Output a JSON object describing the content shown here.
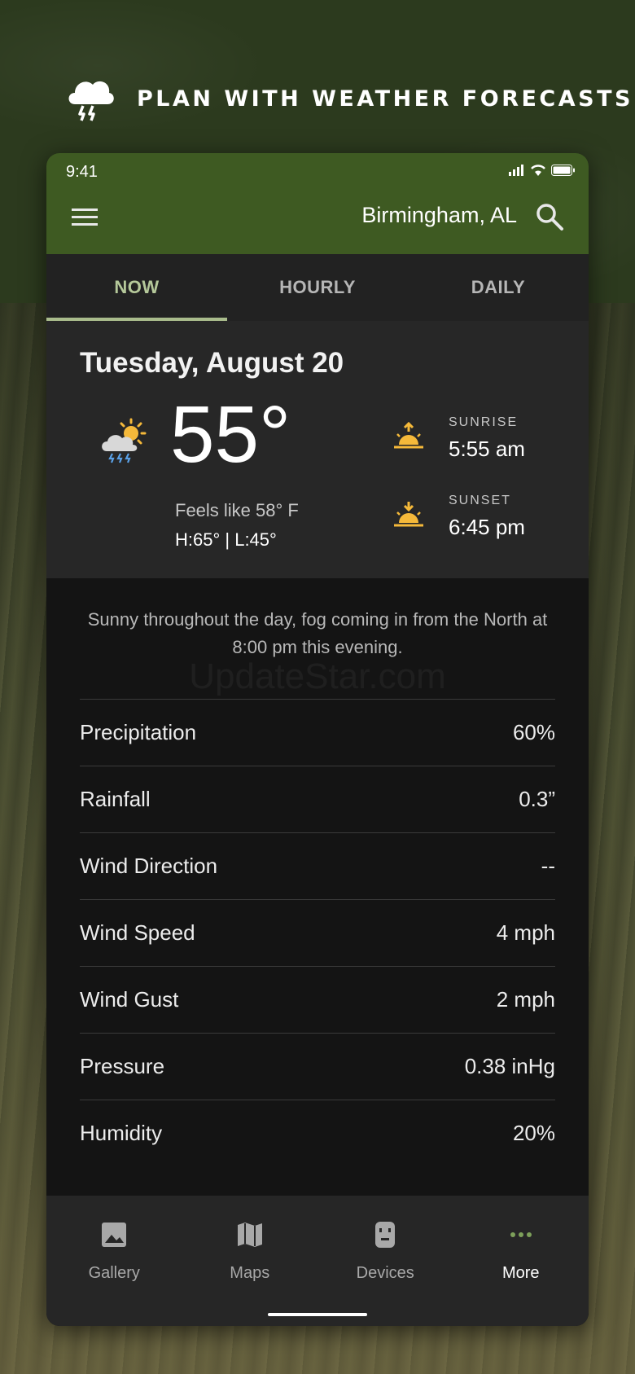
{
  "banner": {
    "title": "PLAN WITH WEATHER FORECASTS",
    "icon": "storm-cloud-icon"
  },
  "status_bar": {
    "time": "9:41"
  },
  "app_bar": {
    "location": "Birmingham, AL"
  },
  "tabs": [
    {
      "label": "NOW",
      "active": true
    },
    {
      "label": "HOURLY",
      "active": false
    },
    {
      "label": "DAILY",
      "active": false
    }
  ],
  "now": {
    "date": "Tuesday, August 20",
    "temperature": "55°",
    "feels_like": "Feels like 58° F",
    "high_low": "H:65° | L:45°",
    "condition_icon": "partly-sunny-thunderstorm-icon",
    "sunrise_label": "SUNRISE",
    "sunrise_time": "5:55 am",
    "sunset_label": "SUNSET",
    "sunset_time": "6:45 pm"
  },
  "summary": "Sunny throughout the day, fog coming in from the North at 8:00 pm this evening.",
  "watermark": "UpdateStar.com",
  "details": [
    {
      "label": "Precipitation",
      "value": "60%"
    },
    {
      "label": "Rainfall",
      "value": "0.3”"
    },
    {
      "label": "Wind Direction",
      "value": "--"
    },
    {
      "label": "Wind Speed",
      "value": "4 mph"
    },
    {
      "label": "Wind Gust",
      "value": "2 mph"
    },
    {
      "label": "Pressure",
      "value": "0.38 inHg"
    },
    {
      "label": "Humidity",
      "value": "20%"
    }
  ],
  "bottom_nav": [
    {
      "label": "Gallery",
      "icon": "image-icon",
      "active": false
    },
    {
      "label": "Maps",
      "icon": "map-icon",
      "active": false
    },
    {
      "label": "Devices",
      "icon": "trail-camera-icon",
      "active": false
    },
    {
      "label": "More",
      "icon": "more-dots-icon",
      "active": true
    }
  ],
  "colors": {
    "app_bar": "#3e5a22",
    "active_tab": "#b5c89a",
    "sun_icon": "#f5b93a",
    "more_icon": "#7da05a"
  }
}
